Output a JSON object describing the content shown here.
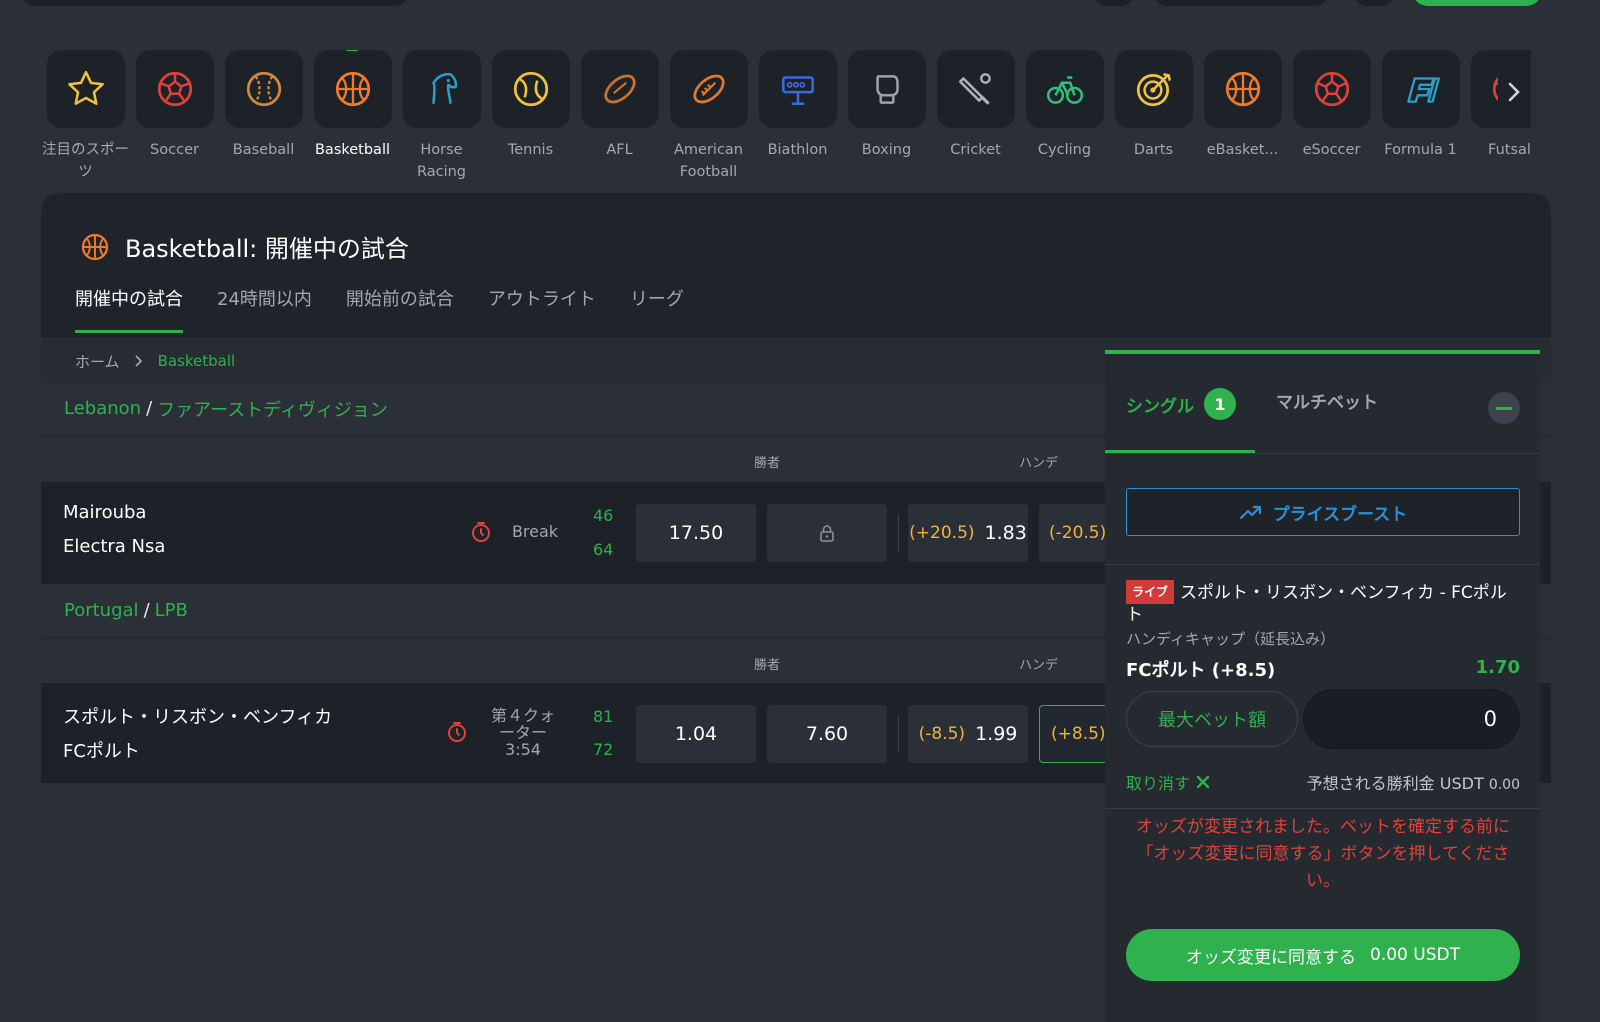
{
  "sports_nav": {
    "items": [
      {
        "label": "注目のスポーツ",
        "icon": "star-icon",
        "color": "#f2c23d",
        "active": false
      },
      {
        "label": "Soccer",
        "icon": "soccer-ball-icon",
        "color": "#e0403a",
        "active": false
      },
      {
        "label": "Baseball",
        "icon": "baseball-icon",
        "color": "#d08a38",
        "active": false
      },
      {
        "label": "Basketball",
        "icon": "basketball-icon",
        "color": "#f07a2a",
        "active": true
      },
      {
        "label": "Horse Racing",
        "icon": "horse-head-icon",
        "color": "#2c9fc8",
        "active": false
      },
      {
        "label": "Tennis",
        "icon": "tennis-ball-icon",
        "color": "#f2c23d",
        "active": false
      },
      {
        "label": "AFL",
        "icon": "afl-ball-icon",
        "color": "#c8732e",
        "active": false
      },
      {
        "label": "American Football",
        "icon": "american-football-icon",
        "color": "#e07a2a",
        "active": false
      },
      {
        "label": "Biathlon",
        "icon": "biathlon-target-icon",
        "color": "#3a6ae0",
        "active": false
      },
      {
        "label": "Boxing",
        "icon": "boxing-glove-icon",
        "color": "#9aa2ab",
        "active": false
      },
      {
        "label": "Cricket",
        "icon": "cricket-bat-icon",
        "color": "#b0b4b9",
        "active": false
      },
      {
        "label": "Cycling",
        "icon": "bicycle-icon",
        "color": "#2fc07a",
        "active": false
      },
      {
        "label": "Darts",
        "icon": "dartboard-icon",
        "color": "#f2c23d",
        "active": false
      },
      {
        "label": "eBasket...",
        "icon": "ebasketball-icon",
        "color": "#f07a2a",
        "active": false
      },
      {
        "label": "eSoccer",
        "icon": "esoccer-ball-icon",
        "color": "#e0403a",
        "active": false
      },
      {
        "label": "Formula 1",
        "icon": "formula1-icon",
        "color": "#2c9fc8",
        "active": false
      },
      {
        "label": "Futsal",
        "icon": "futsal-ball-icon",
        "color": "#e0403a",
        "active": false
      }
    ]
  },
  "page": {
    "title": "Basketball: 開催中の試合",
    "tabs": [
      "開催中の試合",
      "24時間以内",
      "開始前の試合",
      "アウトライト",
      "リーグ"
    ],
    "breadcrumb": {
      "home": "ホーム",
      "current": "Basketball"
    }
  },
  "leagues": [
    {
      "country": "Lebanon",
      "league": "ファアーストディヴィジョン",
      "col_winner": "勝者",
      "col_handicap": "ハンデ",
      "match": {
        "team1": "Mairouba",
        "team2": "Electra Nsa",
        "status": "Break",
        "score1": "46",
        "score2": "64",
        "winner1": "17.50",
        "hc1_line": "(+20.5)",
        "hc1_price": "1.83",
        "hc2_line": "(-20.5)"
      }
    },
    {
      "country": "Portugal",
      "league": "LPB",
      "col_winner": "勝者",
      "col_handicap": "ハンデ",
      "match": {
        "team1": "スポルト・リスボン・ベンフィカ",
        "team2": "FCポルト",
        "status": "第４クォーター",
        "clock": "3:54",
        "score1": "81",
        "score2": "72",
        "winner1": "1.04",
        "winner2": "7.60",
        "hc1_line": "(-8.5)",
        "hc1_price": "1.99",
        "hc2_line": "(+8.5)"
      }
    }
  ],
  "betslip": {
    "tab_single": "シングル",
    "single_count": "1",
    "tab_multi": "マルチベット",
    "price_boost": "プライスブースト",
    "live_badge": "ライブ",
    "event": "スポルト・リスボン・ベンフィカ - FCポルト",
    "market": "ハンディキャップ（延長込み）",
    "selection": "FCポルト (+8.5)",
    "price": "1.70",
    "max_bet": "最大ベット額",
    "stake": "0",
    "cancel": "取り消す",
    "win_label": "予想される勝利金 USDT",
    "win_amount": "0.00",
    "odds_changed_msg": "オッズが変更されました。ベットを確定する前に「オッズ変更に同意する」ボタンを押してください。",
    "accept_label": "オッズ変更に同意する",
    "accept_amount": "0.00 USDT"
  },
  "colors": {
    "accent": "#2fb14d",
    "handicap": "#f0b43c",
    "boost": "#2d8fd6",
    "warning": "#e0423a",
    "live": "#d33a3a"
  }
}
